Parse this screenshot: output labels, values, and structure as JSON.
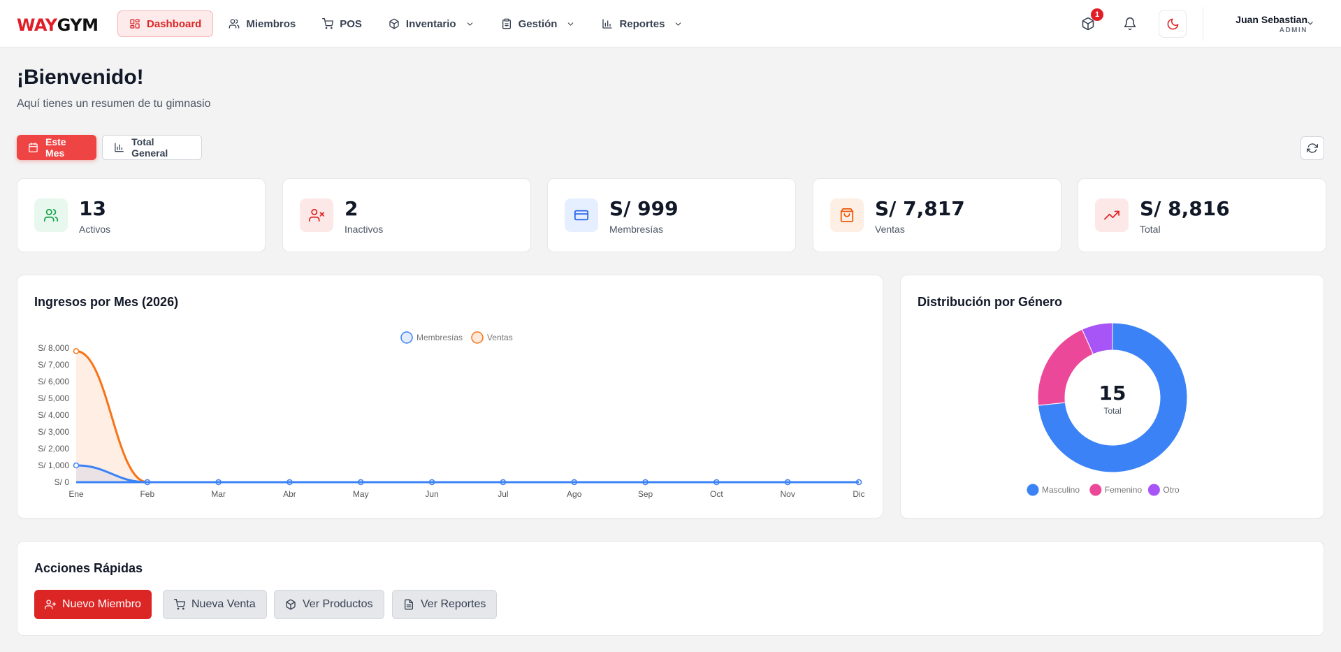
{
  "brand": {
    "part1": "WAY",
    "part2": "GYM"
  },
  "nav": [
    {
      "label": "Dashboard",
      "icon": "layout-dashboard-icon",
      "active": true
    },
    {
      "label": "Miembros",
      "icon": "users-icon"
    },
    {
      "label": "POS",
      "icon": "shopping-cart-icon"
    },
    {
      "label": "Inventario",
      "icon": "package-icon",
      "dropdown": true
    },
    {
      "label": "Gestión",
      "icon": "clipboard-icon",
      "dropdown": true
    },
    {
      "label": "Reportes",
      "icon": "bar-chart-icon",
      "dropdown": true
    }
  ],
  "header": {
    "notifications_count": "1",
    "user_name": "Juan Sebastian",
    "user_role": "ADMIN"
  },
  "page": {
    "title": "¡Bienvenido!",
    "subtitle": "Aquí tienes un resumen de tu gimnasio"
  },
  "period_buttons": {
    "this_month": "Este Mes",
    "total": "Total General"
  },
  "stats": [
    {
      "value": "13",
      "label": "Activos",
      "icon": "users-icon",
      "color": "#16a34a",
      "bg": "#e8f8ee"
    },
    {
      "value": "2",
      "label": "Inactivos",
      "icon": "user-x-icon",
      "color": "#dc2626",
      "bg": "#fde8e8"
    },
    {
      "value": "S/ 999",
      "label": "Membresías",
      "icon": "credit-card-icon",
      "color": "#2563eb",
      "bg": "#e6efff"
    },
    {
      "value": "S/ 7,817",
      "label": "Ventas",
      "icon": "shopping-bag-icon",
      "color": "#ea580c",
      "bg": "#fdefe3"
    },
    {
      "value": "S/ 8,816",
      "label": "Total",
      "icon": "trending-up-icon",
      "color": "#dc2626",
      "bg": "#fde8e8"
    }
  ],
  "income_chart": {
    "title": "Ingresos por Mes (2026)"
  },
  "gender_chart": {
    "title": "Distribución por Género",
    "center_value": "15",
    "center_label": "Total"
  },
  "chart_data": [
    {
      "type": "line",
      "title": "Ingresos por Mes (2026)",
      "categories": [
        "Ene",
        "Feb",
        "Mar",
        "Abr",
        "May",
        "Jun",
        "Jul",
        "Ago",
        "Sep",
        "Oct",
        "Nov",
        "Dic"
      ],
      "y_ticks": [
        "S/ 0",
        "S/ 1,000",
        "S/ 2,000",
        "S/ 3,000",
        "S/ 4,000",
        "S/ 5,000",
        "S/ 6,000",
        "S/ 7,000",
        "S/ 8,000"
      ],
      "ylim": [
        0,
        8000
      ],
      "legend_position": "top-center",
      "grid": false,
      "series": [
        {
          "name": "Membresías",
          "color": "#3b82f6",
          "values": [
            999,
            0,
            0,
            0,
            0,
            0,
            0,
            0,
            0,
            0,
            0,
            0
          ]
        },
        {
          "name": "Ventas",
          "color": "#f97316",
          "values": [
            7817,
            0,
            0,
            0,
            0,
            0,
            0,
            0,
            0,
            0,
            0,
            0
          ]
        }
      ]
    },
    {
      "type": "pie",
      "title": "Distribución por Género",
      "legend_position": "bottom",
      "slices": [
        {
          "name": "Masculino",
          "value": 11,
          "color": "#3b82f6"
        },
        {
          "name": "Femenino",
          "value": 3,
          "color": "#ec4899"
        },
        {
          "name": "Otro",
          "value": 1,
          "color": "#a855f7"
        }
      ]
    }
  ],
  "quick_actions": {
    "title": "Acciones Rápidas",
    "buttons": [
      {
        "label": "Nuevo Miembro",
        "icon": "user-plus-icon"
      },
      {
        "label": "Nueva Venta",
        "icon": "shopping-cart-icon"
      },
      {
        "label": "Ver Productos",
        "icon": "package-icon"
      },
      {
        "label": "Ver Reportes",
        "icon": "file-text-icon"
      }
    ]
  }
}
